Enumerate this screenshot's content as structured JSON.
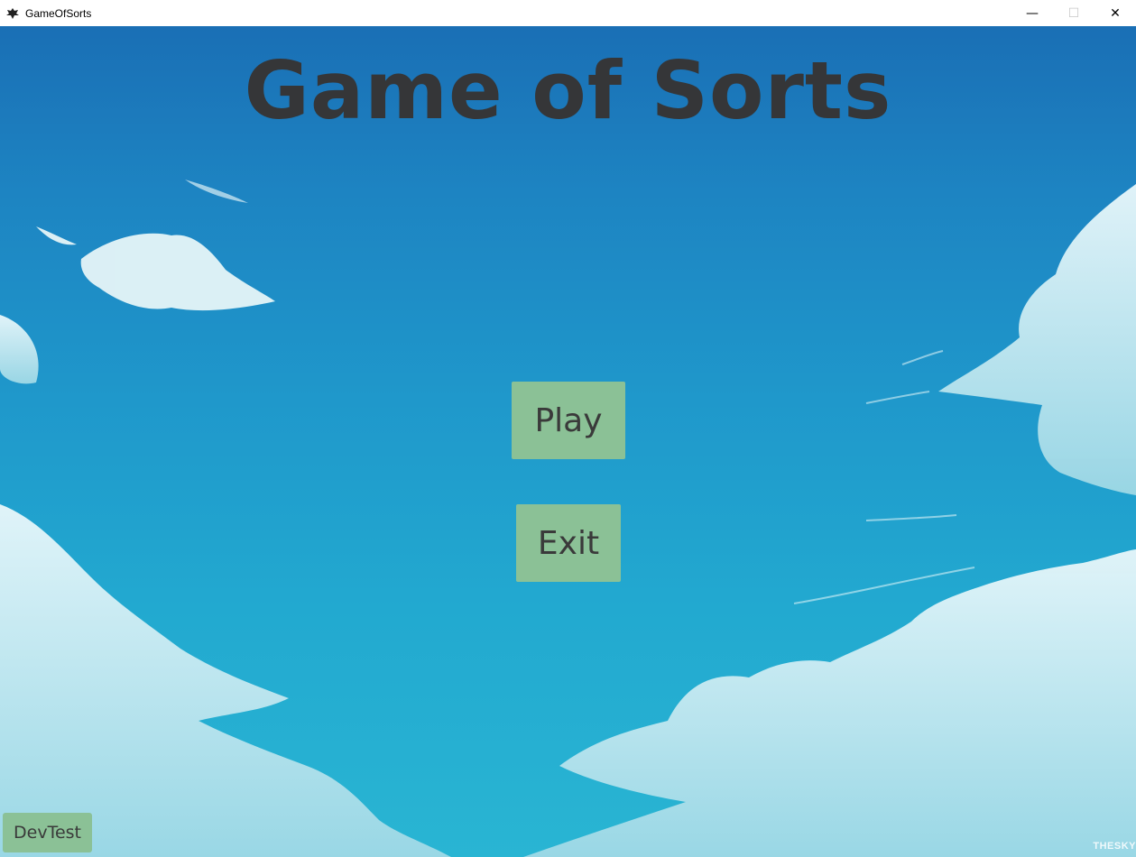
{
  "window": {
    "title": "GameOfSorts",
    "icon": "raven-icon",
    "controls": {
      "minimize": "—",
      "maximize": "☐",
      "close": "✕"
    }
  },
  "menu": {
    "title": "Game of Sorts",
    "play_label": "Play",
    "exit_label": "Exit",
    "devtest_label": "DevTest"
  },
  "background": {
    "watermark": "THESKY",
    "sky_top_color": "#1a6fb5",
    "sky_bottom_color": "#29b5d3",
    "cloud_color": "#dff3f8"
  },
  "colors": {
    "button_fill": "#8bc196",
    "button_text": "#3a3a3a",
    "title_text": "#353638"
  }
}
